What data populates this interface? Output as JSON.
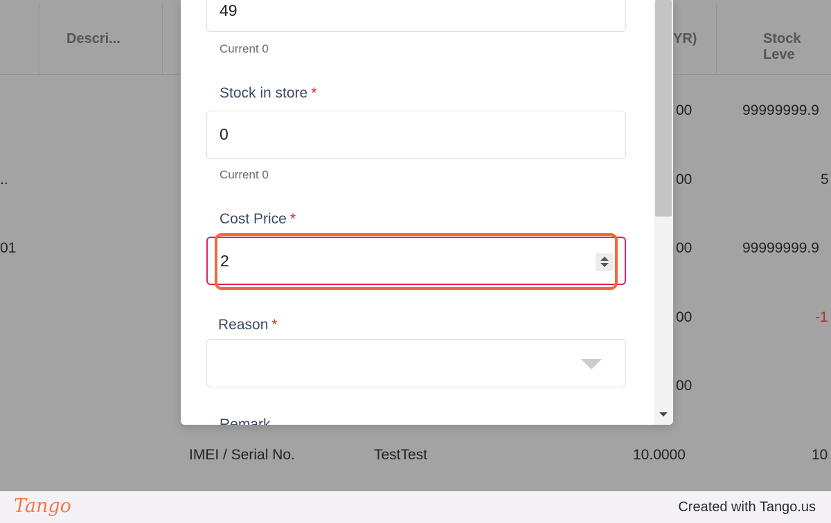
{
  "background_table": {
    "headers": {
      "description": "Descri...",
      "price_suffix": "YR)",
      "stock_level": "Stock Leve"
    },
    "rows": [
      {
        "price_frag": "00",
        "stock": "99999999.9"
      },
      {
        "left_frag": "..",
        "price_frag": "00",
        "stock": "5"
      },
      {
        "left_frag": "01",
        "price_frag": "00",
        "stock": "99999999.9"
      },
      {
        "price_frag": "00",
        "stock": "-1"
      },
      {
        "price_frag": "00"
      },
      {
        "type": "IMEI / Serial No.",
        "name": "TestTest",
        "price": "10.0000",
        "stock": "10"
      }
    ]
  },
  "modal": {
    "top_field": {
      "value": "49",
      "hint": "Current 0"
    },
    "stock_in_store": {
      "label": "Stock in store",
      "required_mark": "*",
      "value": "0",
      "hint": "Current 0"
    },
    "cost_price": {
      "label": "Cost Price",
      "required_mark": "*",
      "value": "2"
    },
    "reason": {
      "label": "Reason",
      "required_mark": "*",
      "value": ""
    },
    "remark": {
      "label": "Remark"
    }
  },
  "footer": {
    "logo": "Tango",
    "credit": "Created with Tango.us"
  },
  "colors": {
    "highlight": "#f06a3b",
    "active_border": "#e0245e",
    "required": "#c0392b"
  }
}
